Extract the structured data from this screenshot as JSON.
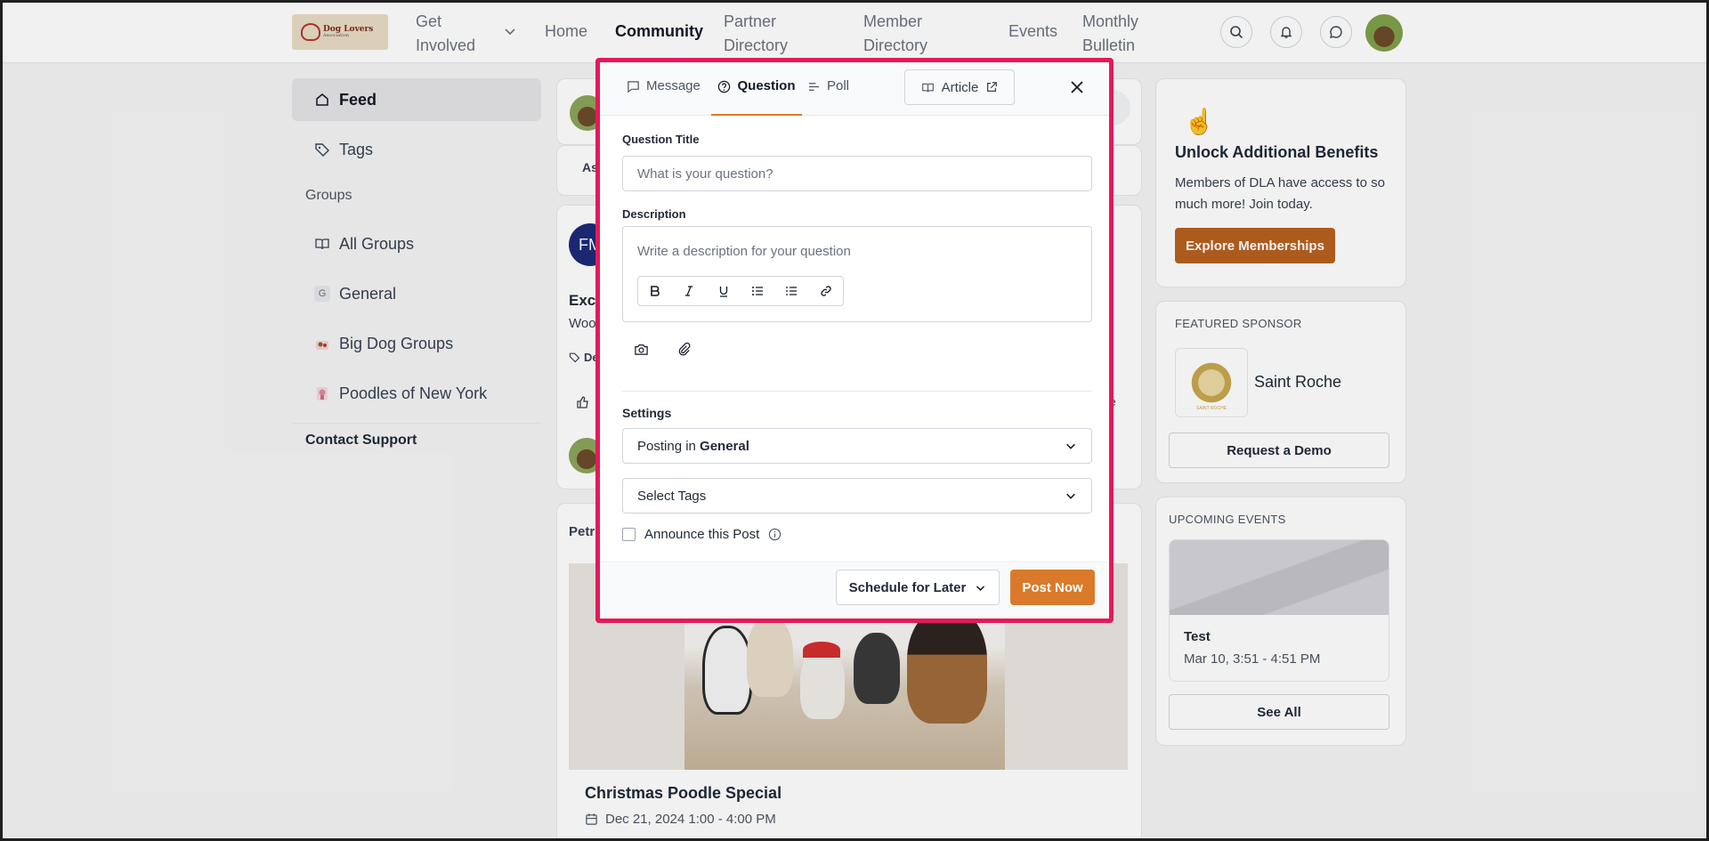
{
  "nav": {
    "logo_text": "Dog Lovers",
    "logo_sub": "Association",
    "get_involved_line1": "Get",
    "get_involved_line2": "Involved",
    "home": "Home",
    "community": "Community",
    "partner_line1": "Partner",
    "partner_line2": "Directory",
    "member_line1": "Member",
    "member_line2": "Directory",
    "events": "Events",
    "bulletin_line1": "Monthly",
    "bulletin_line2": "Bulletin"
  },
  "sidebar": {
    "feed": "Feed",
    "tags": "Tags",
    "groups_heading": "Groups",
    "all_groups": "All Groups",
    "general": "General",
    "general_badge": "G",
    "big_dog_groups": "Big Dog Groups",
    "poodles": "Poodles of New York",
    "contact_support": "Contact Support"
  },
  "feed": {
    "ask_fragment": "Ask",
    "fm_initials": "FM",
    "excite_fragment": "Exci",
    "woo_fragment": "Woo",
    "tag_fragment": "De",
    "e_fragment": "e",
    "petr_fragment": "Petr",
    "event_title": "Christmas Poodle Special",
    "event_date": "Dec 21, 2024 1:00 - 4:00 PM"
  },
  "right": {
    "benefits_title": "Unlock Additional Benefits",
    "benefits_body": "Members of DLA have access to so much more! Join today.",
    "explore_button": "Explore Memberships",
    "sponsor_heading": "FEATURED SPONSOR",
    "sponsor_name": "Saint Roche",
    "sponsor_logo_text": "SAINT ROCHE",
    "demo_button": "Request a Demo",
    "events_heading": "UPCOMING EVENTS",
    "event_name": "Test",
    "event_time": "Mar 10, 3:51 - 4:51 PM",
    "see_all": "See All"
  },
  "modal": {
    "tabs": {
      "message": "Message",
      "question": "Question",
      "poll": "Poll",
      "article": "Article"
    },
    "question_title_label": "Question Title",
    "question_title_placeholder": "What is your question?",
    "description_label": "Description",
    "description_placeholder": "Write a description for your question",
    "settings_label": "Settings",
    "posting_prefix": "Posting in",
    "posting_group": "General",
    "select_tags": "Select Tags",
    "announce_label": "Announce this Post",
    "schedule_button": "Schedule for Later",
    "post_now_button": "Post Now"
  },
  "colors": {
    "accent_orange": "#d97a2b",
    "highlight_border": "#e5195a",
    "explore_brown": "#b8611f"
  }
}
